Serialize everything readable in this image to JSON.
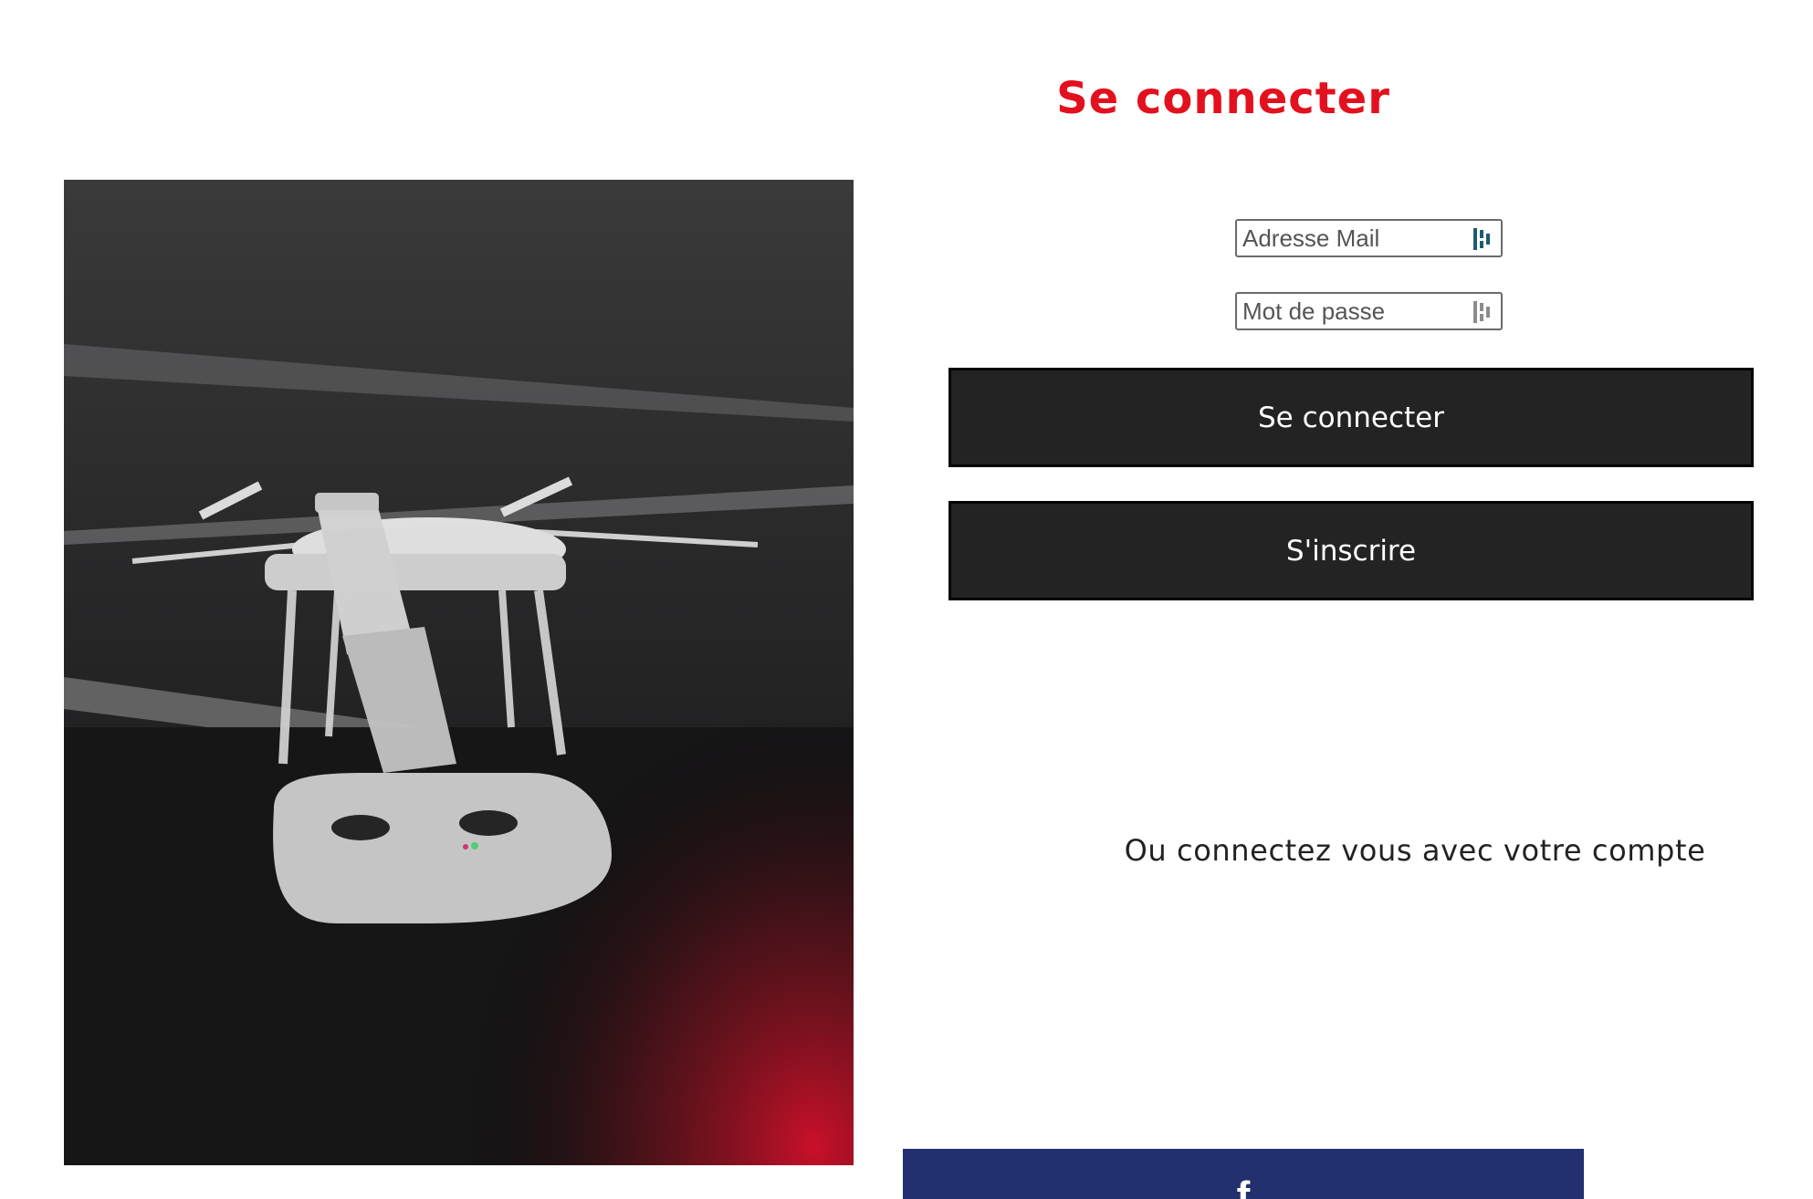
{
  "colors": {
    "title": "#e3101e",
    "button_bg": "#232323",
    "facebook_blue": "#22306f",
    "text": "#222222"
  },
  "login": {
    "title": "Se connecter",
    "email_placeholder": "Adresse Mail",
    "password_placeholder": "Mot de passe",
    "submit_label": "Se connecter",
    "signup_label": "S'inscrire",
    "alt_login_text": "Ou connectez vous avec votre compte"
  },
  "social": {
    "facebook_icon": "facebook-f-icon"
  },
  "icons": {
    "field_autofill": "password-manager-icon"
  }
}
